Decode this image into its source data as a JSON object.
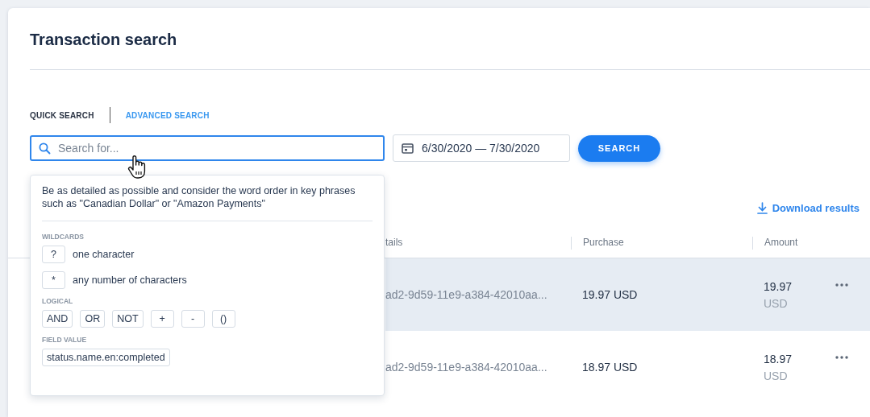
{
  "title": "Transaction search",
  "tabs": [
    {
      "label": "QUICK SEARCH",
      "selected": true
    },
    {
      "label": "ADVANCED SEARCH",
      "selected": false
    }
  ],
  "search": {
    "placeholder": "Search for..."
  },
  "date_range": {
    "value": "6/30/2020 — 7/30/2020"
  },
  "search_button": "SEARCH",
  "download": "Download results",
  "help": {
    "text": "Be as detailed as possible and consider the word order in key phrases such as \"Canadian Dollar\" or \"Amazon Payments\"",
    "sections": [
      {
        "heading": "WILDCARDS",
        "kind": "described",
        "items": [
          {
            "key": "?",
            "description": "one character"
          },
          {
            "key": "*",
            "description": "any number of characters"
          }
        ]
      },
      {
        "heading": "LOGICAL",
        "kind": "inline",
        "items": [
          {
            "key": "AND"
          },
          {
            "key": "OR"
          },
          {
            "key": "NOT"
          },
          {
            "key": "+"
          },
          {
            "key": "-"
          },
          {
            "key": "()"
          }
        ]
      },
      {
        "heading": "FIELD VALUE",
        "kind": "inline",
        "items": [
          {
            "key": "status.name.en:completed"
          }
        ]
      }
    ]
  },
  "table": {
    "columns": [
      "tails",
      "Purchase",
      "Amount"
    ],
    "rows": [
      {
        "details": "ad2-9d59-11e9-a384-42010aa...",
        "purchase": "19.97 USD",
        "amount": "19.97",
        "currency": "USD",
        "highlighted": true
      },
      {
        "details": "ad2-9d59-11e9-a384-42010aa...",
        "purchase": "18.97 USD",
        "amount": "18.97",
        "currency": "USD",
        "highlighted": false
      }
    ]
  }
}
